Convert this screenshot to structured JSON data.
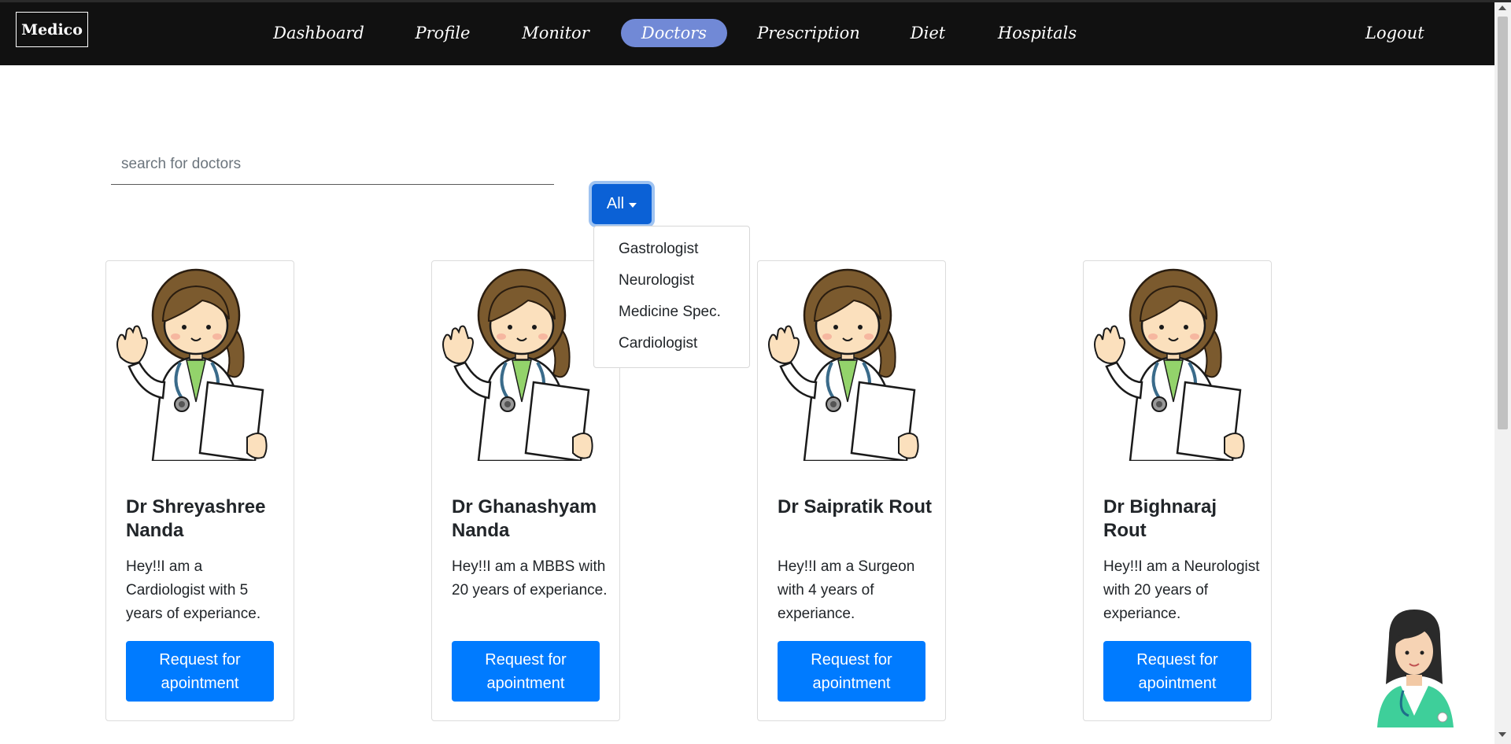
{
  "brand": "Medico",
  "nav": {
    "items": [
      {
        "label": "Dashboard"
      },
      {
        "label": "Profile"
      },
      {
        "label": "Monitor"
      },
      {
        "label": "Doctors",
        "active": true
      },
      {
        "label": "Prescription"
      },
      {
        "label": "Diet"
      },
      {
        "label": "Hospitals"
      }
    ],
    "logout": "Logout",
    "active_color": "#7189d6",
    "background": "#111111"
  },
  "search": {
    "placeholder": "search for doctors",
    "value": ""
  },
  "filter": {
    "selected": "All",
    "options": [
      "Gastrologist",
      "Neurologist",
      "Medicine Spec.",
      "Cardiologist"
    ]
  },
  "doctors": [
    {
      "name": "Dr Shreyashree Nanda",
      "desc": "Hey!!I am a Cardiologist with 5 years of experiance.",
      "button": "Request for apointment"
    },
    {
      "name": "Dr Ghanashyam Nanda",
      "desc": "Hey!!I am a MBBS with 20 years of experiance.",
      "button": "Request for apointment"
    },
    {
      "name": "Dr Saipratik Rout",
      "desc": "Hey!!I am a Surgeon with 4 years of experiance.",
      "button": "Request for apointment"
    },
    {
      "name": "Dr Bighnaraj Rout",
      "desc": "Hey!!I am a Neurologist with 20 years of experiance.",
      "button": "Request for apointment"
    }
  ],
  "colors": {
    "primary": "#007bff",
    "filter_button": "#0b61d6"
  },
  "icons": {
    "doctor_image": "doctor-illustration-icon",
    "assistant": "nurse-assistant-icon"
  }
}
